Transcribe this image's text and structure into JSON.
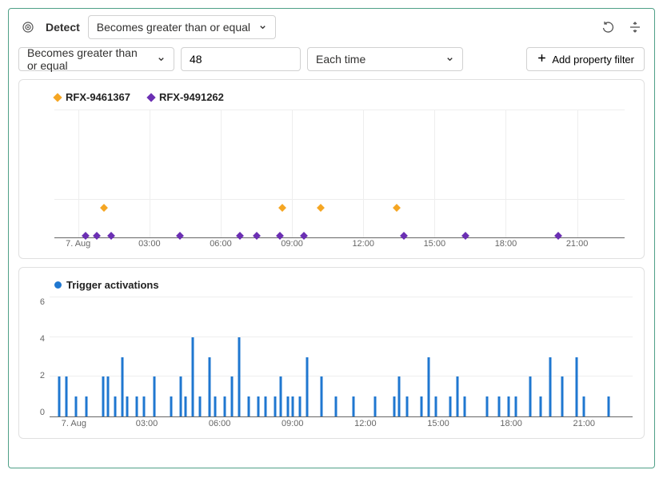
{
  "header": {
    "title": "Detect",
    "condition": "Becomes greater than or equal"
  },
  "filters": {
    "condition": "Becomes greater than or equal",
    "threshold": "48",
    "frequency": "Each time",
    "add_filter_label": "Add property filter"
  },
  "x_ticks": [
    "7. Aug",
    "03:00",
    "06:00",
    "09:00",
    "12:00",
    "15:00",
    "18:00",
    "21:00"
  ],
  "chart_data": [
    {
      "type": "scatter",
      "title": "",
      "x_range_hours": [
        -1,
        23
      ],
      "series": [
        {
          "name": "RFX-9461367",
          "color": "#f5a623",
          "points": [
            {
              "x": 1.1,
              "y": 1
            },
            {
              "x": 8.6,
              "y": 1
            },
            {
              "x": 10.2,
              "y": 1
            },
            {
              "x": 13.4,
              "y": 1
            }
          ]
        },
        {
          "name": "RFX-9491262",
          "color": "#6b2fb3",
          "points": [
            {
              "x": 0.3,
              "y": 0
            },
            {
              "x": 0.8,
              "y": 0
            },
            {
              "x": 1.4,
              "y": 0
            },
            {
              "x": 4.3,
              "y": 0
            },
            {
              "x": 6.8,
              "y": 0
            },
            {
              "x": 7.5,
              "y": 0
            },
            {
              "x": 8.5,
              "y": 0
            },
            {
              "x": 9.5,
              "y": 0
            },
            {
              "x": 13.7,
              "y": 0
            },
            {
              "x": 16.3,
              "y": 0
            },
            {
              "x": 20.2,
              "y": 0
            }
          ]
        }
      ]
    },
    {
      "type": "bar",
      "title": "Trigger activations",
      "ylabel": "",
      "ylim": [
        0,
        6
      ],
      "x_range_hours": [
        -1,
        23
      ],
      "color": "#1f77d0",
      "data": [
        {
          "x": -0.6,
          "y": 2
        },
        {
          "x": -0.3,
          "y": 2
        },
        {
          "x": 0.1,
          "y": 1
        },
        {
          "x": 0.5,
          "y": 1
        },
        {
          "x": 1.2,
          "y": 2
        },
        {
          "x": 1.4,
          "y": 2
        },
        {
          "x": 1.7,
          "y": 1
        },
        {
          "x": 2.0,
          "y": 3
        },
        {
          "x": 2.2,
          "y": 1
        },
        {
          "x": 2.6,
          "y": 1
        },
        {
          "x": 2.9,
          "y": 1
        },
        {
          "x": 3.3,
          "y": 2
        },
        {
          "x": 4.0,
          "y": 1
        },
        {
          "x": 4.4,
          "y": 2
        },
        {
          "x": 4.6,
          "y": 1
        },
        {
          "x": 4.9,
          "y": 4
        },
        {
          "x": 5.2,
          "y": 1
        },
        {
          "x": 5.6,
          "y": 3
        },
        {
          "x": 5.8,
          "y": 1
        },
        {
          "x": 6.2,
          "y": 1
        },
        {
          "x": 6.5,
          "y": 2
        },
        {
          "x": 6.8,
          "y": 4
        },
        {
          "x": 7.2,
          "y": 1
        },
        {
          "x": 7.6,
          "y": 1
        },
        {
          "x": 7.9,
          "y": 1
        },
        {
          "x": 8.3,
          "y": 1
        },
        {
          "x": 8.5,
          "y": 2
        },
        {
          "x": 8.8,
          "y": 1
        },
        {
          "x": 9.0,
          "y": 1
        },
        {
          "x": 9.3,
          "y": 1
        },
        {
          "x": 9.6,
          "y": 3
        },
        {
          "x": 10.2,
          "y": 2
        },
        {
          "x": 10.8,
          "y": 1
        },
        {
          "x": 11.5,
          "y": 1
        },
        {
          "x": 12.4,
          "y": 1
        },
        {
          "x": 13.2,
          "y": 1
        },
        {
          "x": 13.4,
          "y": 2
        },
        {
          "x": 13.7,
          "y": 1
        },
        {
          "x": 14.3,
          "y": 1
        },
        {
          "x": 14.6,
          "y": 3
        },
        {
          "x": 14.9,
          "y": 1
        },
        {
          "x": 15.5,
          "y": 1
        },
        {
          "x": 15.8,
          "y": 2
        },
        {
          "x": 16.1,
          "y": 1
        },
        {
          "x": 17.0,
          "y": 1
        },
        {
          "x": 17.5,
          "y": 1
        },
        {
          "x": 17.9,
          "y": 1
        },
        {
          "x": 18.2,
          "y": 1
        },
        {
          "x": 18.8,
          "y": 2
        },
        {
          "x": 19.2,
          "y": 1
        },
        {
          "x": 19.6,
          "y": 3
        },
        {
          "x": 20.1,
          "y": 2
        },
        {
          "x": 20.7,
          "y": 3
        },
        {
          "x": 21.0,
          "y": 1
        },
        {
          "x": 22.0,
          "y": 1
        }
      ]
    }
  ]
}
